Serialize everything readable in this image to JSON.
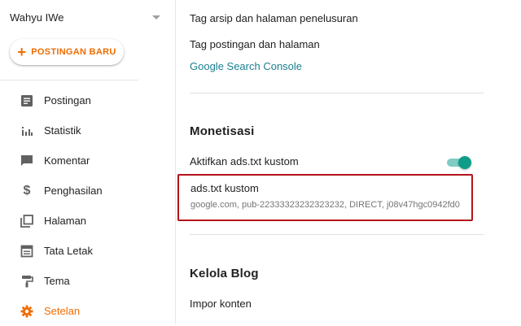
{
  "sidebar": {
    "blog_name": "Wahyu IWe",
    "new_post_label": "POSTINGAN BARU",
    "items": [
      {
        "label": "Postingan",
        "icon": "posts-icon"
      },
      {
        "label": "Statistik",
        "icon": "stats-icon"
      },
      {
        "label": "Komentar",
        "icon": "comment-icon"
      },
      {
        "label": "Penghasilan",
        "icon": "dollar-icon"
      },
      {
        "label": "Halaman",
        "icon": "pages-icon"
      },
      {
        "label": "Tata Letak",
        "icon": "layout-icon"
      },
      {
        "label": "Tema",
        "icon": "paint-roller-icon"
      },
      {
        "label": "Setelan",
        "icon": "gear-icon",
        "active": true
      }
    ]
  },
  "main": {
    "row_partial": "Tag arsip dan halaman penelusuran",
    "row_tags": "Tag postingan dan halaman",
    "gsc_link": "Google Search Console",
    "monetisasi": {
      "title": "Monetisasi",
      "toggle_label": "Aktifkan ads.txt kustom",
      "toggle_on": true,
      "ads_title": "ads.txt kustom",
      "ads_value": "google.com, pub-22333323232323232, DIRECT, j08v47hgc0942fd0"
    },
    "kelola": {
      "title": "Kelola Blog",
      "import_label": "Impor konten"
    }
  },
  "colors": {
    "accent": "#ef6c00",
    "teal": "#0f9d8a",
    "link": "#1a7f8f",
    "highlight_border": "#b5121b"
  }
}
